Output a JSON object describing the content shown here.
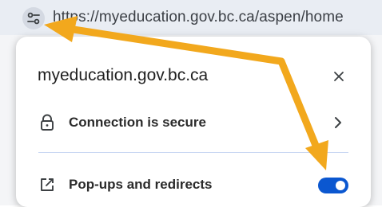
{
  "address_bar": {
    "url": "https://myeducation.gov.bc.ca/aspen/home",
    "site_info_icon": "tune-icon"
  },
  "site_popup": {
    "title": "myeducation.gov.bc.ca",
    "close_icon": "close-icon",
    "connection": {
      "label": "Connection is secure",
      "icon": "lock-icon",
      "chevron_icon": "chevron-right-icon"
    },
    "popups_redirects": {
      "label": "Pop-ups and redirects",
      "icon": "open-in-new-icon",
      "enabled": true
    }
  },
  "colors": {
    "accent": "#0b57d0",
    "annotation_arrow": "#f2a81d",
    "address_bar_bg": "#e9edf3"
  }
}
